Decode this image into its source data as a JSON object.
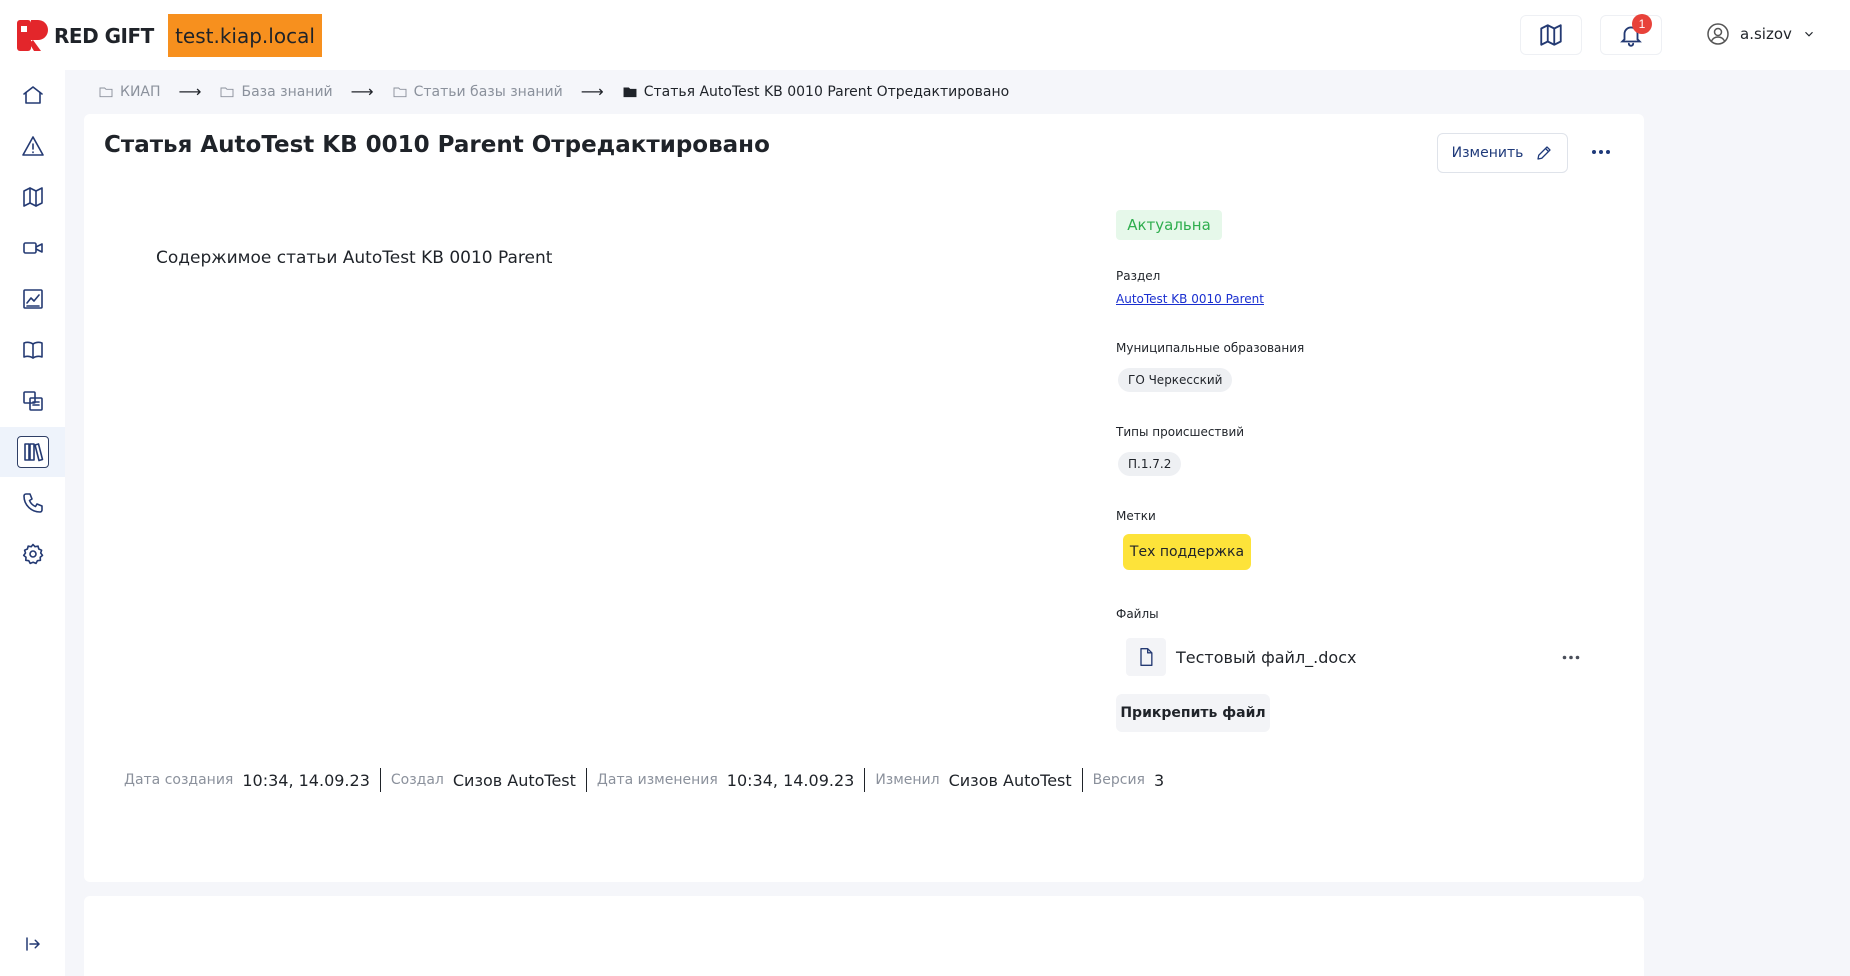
{
  "header": {
    "brand": "RED GIFT",
    "environment": "test.kiap.local",
    "notifications_count": "1",
    "username": "a.sizov"
  },
  "sidebar": {
    "items": [
      {
        "name": "home",
        "icon": "home-icon"
      },
      {
        "name": "incidents",
        "icon": "warning-icon"
      },
      {
        "name": "map",
        "icon": "map-icon"
      },
      {
        "name": "video",
        "icon": "video-icon"
      },
      {
        "name": "analytics",
        "icon": "chart-icon"
      },
      {
        "name": "knowledge-base",
        "icon": "book-icon"
      },
      {
        "name": "documents",
        "icon": "documents-icon"
      },
      {
        "name": "library",
        "icon": "library-icon",
        "active": true
      },
      {
        "name": "calls",
        "icon": "phone-icon"
      },
      {
        "name": "settings",
        "icon": "gear-icon"
      }
    ]
  },
  "breadcrumb": [
    "КИАП",
    "База знаний",
    "Статьи базы знаний",
    "Статья AutoTest KB 0010 Parent Отредактировано"
  ],
  "article": {
    "title": "Статья AutoTest KB 0010 Parent Отредактировано",
    "edit_label": "Изменить",
    "content": "Содержимое статьи AutoTest KB 0010 Parent",
    "status": "Актуальна",
    "section_label": "Раздел",
    "section_value": "AutoTest KB 0010 Parent",
    "municipal_label": "Муниципальные образования",
    "municipal_value": "ГО Черкесский",
    "incident_types_label": "Типы происшествий",
    "incident_type_value": "П.1.7.2",
    "tags_label": "Метки",
    "tag_value": "Тех поддержка",
    "files_label": "Файлы",
    "file_name": "Тестовый файл_.docx",
    "attach_label": "Прикрепить файл"
  },
  "meta": {
    "created_label": "Дата создания",
    "created_value": "10:34, 14.09.23",
    "author_label": "Создал",
    "author_value": "Сизов AutoTest",
    "modified_label": "Дата изменения",
    "modified_value": "10:34, 14.09.23",
    "modifier_label": "Изменил",
    "modifier_value": "Сизов AutoTest",
    "version_label": "Версия",
    "version_value": "3"
  },
  "colors": {
    "brand_red": "#e3262b",
    "env_orange": "#f7901e",
    "nav_blue": "#243a73",
    "status_green": "#2fae4e",
    "tag_yellow": "#fde33a",
    "link_blue": "#1a2fd0"
  }
}
